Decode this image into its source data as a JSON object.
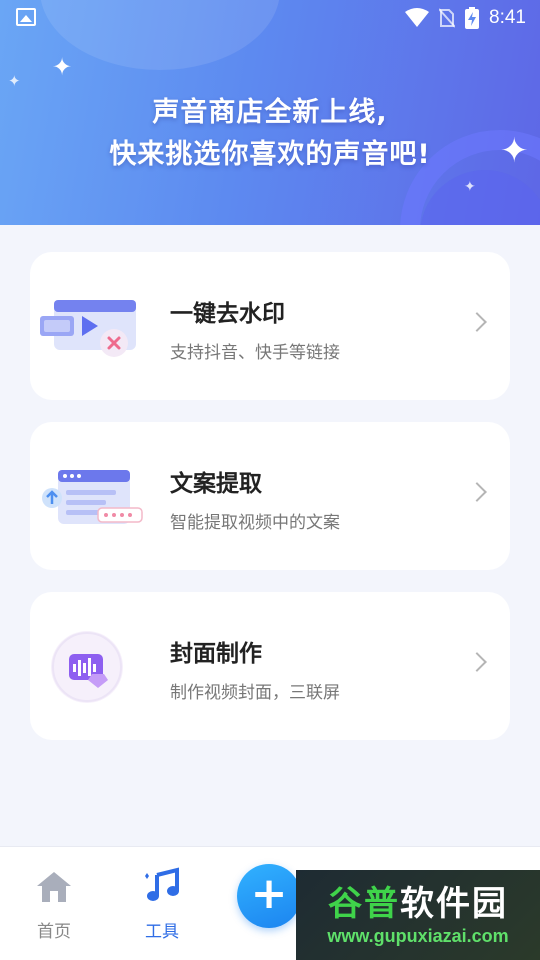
{
  "status_bar": {
    "time": "8:41",
    "icons": [
      "gallery-icon",
      "wifi-icon",
      "no-sim-icon",
      "battery-charging-icon"
    ]
  },
  "banner": {
    "line1": "声音商店全新上线,",
    "line2": "快来挑选你喜欢的声音吧!"
  },
  "tools": [
    {
      "title": "一键去水印",
      "subtitle": "支持抖音、快手等链接",
      "icon": "video-watermark-remove-icon"
    },
    {
      "title": "文案提取",
      "subtitle": "智能提取视频中的文案",
      "icon": "text-extract-icon"
    },
    {
      "title": "封面制作",
      "subtitle": "制作视频封面，三联屏",
      "icon": "cover-make-icon"
    }
  ],
  "tabbar": {
    "home_label": "首页",
    "tools_label": "工具",
    "add_label": "+"
  },
  "colors": {
    "accent": "#2f6de6",
    "banner_start": "#6aa6f5",
    "banner_end": "#5e67e6",
    "add_button": "#1c84f0"
  },
  "watermark": {
    "title_a": "谷普",
    "title_b": "软件园",
    "url": "www.gupuxiazai.com"
  }
}
